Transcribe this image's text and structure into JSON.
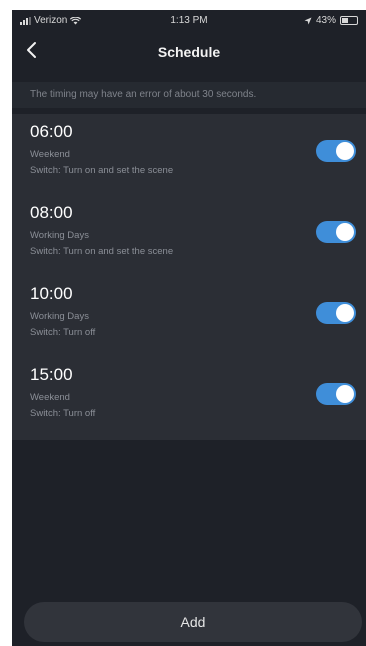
{
  "status_bar": {
    "carrier": "Verizon",
    "time": "1:13 PM",
    "battery": "43%"
  },
  "header": {
    "title": "Schedule"
  },
  "notice": "The timing may have an error of about 30 seconds.",
  "schedules": [
    {
      "time": "06:00",
      "days": "Weekend",
      "action": "Switch: Turn on and set the scene",
      "enabled": true
    },
    {
      "time": "08:00",
      "days": "Working Days",
      "action": "Switch: Turn on and set the scene",
      "enabled": true
    },
    {
      "time": "10:00",
      "days": "Working Days",
      "action": "Switch: Turn off",
      "enabled": true
    },
    {
      "time": "15:00",
      "days": "Weekend",
      "action": "Switch: Turn off",
      "enabled": true
    }
  ],
  "add_button": "Add",
  "colors": {
    "background": "#1e2128",
    "list_background": "#2b2e35",
    "toggle_on": "#3f8ed9"
  }
}
